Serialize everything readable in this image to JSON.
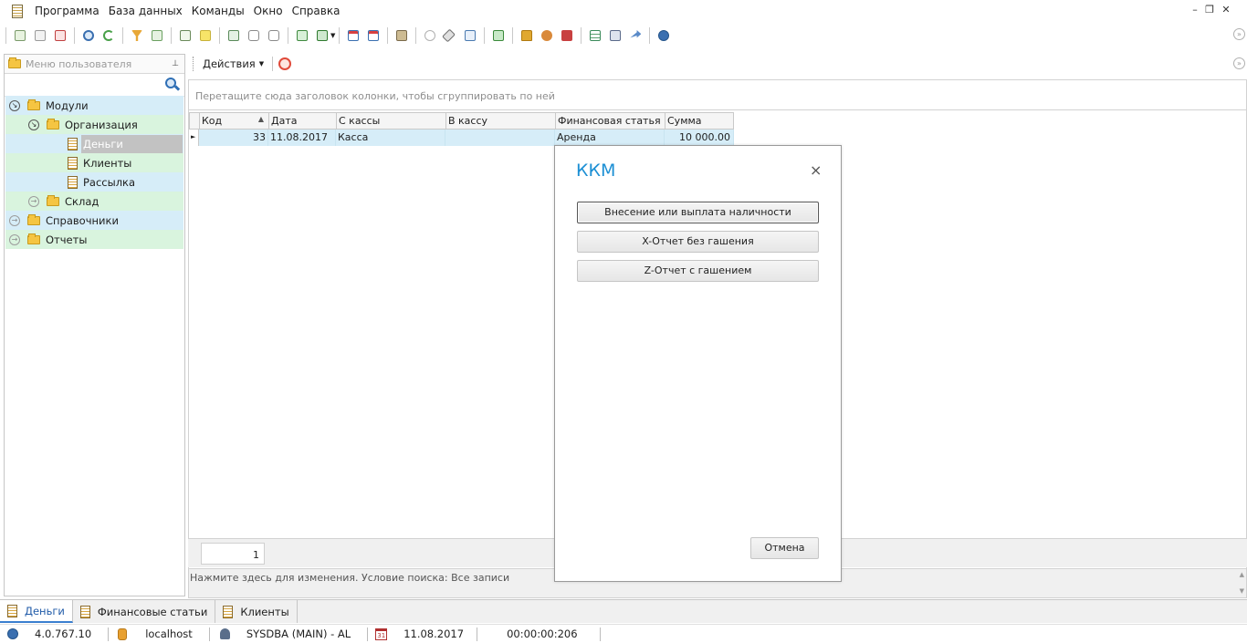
{
  "menubar": {
    "items": [
      "Программа",
      "База данных",
      "Команды",
      "Окно",
      "Справка"
    ]
  },
  "left_panel": {
    "search_placeholder": "Меню пользователя",
    "tree": [
      {
        "label": "Модули",
        "level": 0,
        "expanded": true,
        "kind": "folder"
      },
      {
        "label": "Организация",
        "level": 1,
        "expanded": true,
        "kind": "folder"
      },
      {
        "label": "Деньги",
        "level": 2,
        "kind": "doc",
        "selected": true
      },
      {
        "label": "Клиенты",
        "level": 2,
        "kind": "doc"
      },
      {
        "label": "Рассылка",
        "level": 2,
        "kind": "doc"
      },
      {
        "label": "Склад",
        "level": 1,
        "expanded": false,
        "kind": "folder"
      },
      {
        "label": "Справочники",
        "level": 0,
        "expanded": false,
        "kind": "folder"
      },
      {
        "label": "Отчеты",
        "level": 0,
        "expanded": false,
        "kind": "folder"
      }
    ]
  },
  "actions": {
    "label": "Действия"
  },
  "grid": {
    "group_hint": "Перетащите сюда заголовок колонки, чтобы сгруппировать по ней",
    "columns": [
      "Код",
      "Дата",
      "С кассы",
      "В кассу",
      "Финансовая статья",
      "Сумма"
    ],
    "rows": [
      [
        "33",
        "11.08.2017",
        "Касса",
        "",
        "Аренда",
        "10 000.00"
      ]
    ],
    "record_count": "1",
    "filter_text": "Нажмите здесь для изменения. Условие поиска: Все записи"
  },
  "dialog": {
    "title": "ККМ",
    "close_glyph": "×",
    "buttons": [
      "Внесение или выплата наличности",
      "X-Отчет без гашения",
      "Z-Отчет с гашением"
    ],
    "cancel_label": "Отмена"
  },
  "tabs": [
    "Деньги",
    "Финансовые статьи",
    "Клиенты"
  ],
  "statusbar": {
    "version": "4.0.767.10",
    "host": "localhost",
    "user": "SYSDBA (MAIN) - AL",
    "calendar_day": "31",
    "date": "11.08.2017",
    "timer": "00:00:00:206"
  },
  "colors": {
    "row_blue": "#d6edf8",
    "row_green": "#d9f4de",
    "selected": "#c2c2c2",
    "dialog_title": "#1c8fd4",
    "tab_accent": "#3a7fcf"
  }
}
